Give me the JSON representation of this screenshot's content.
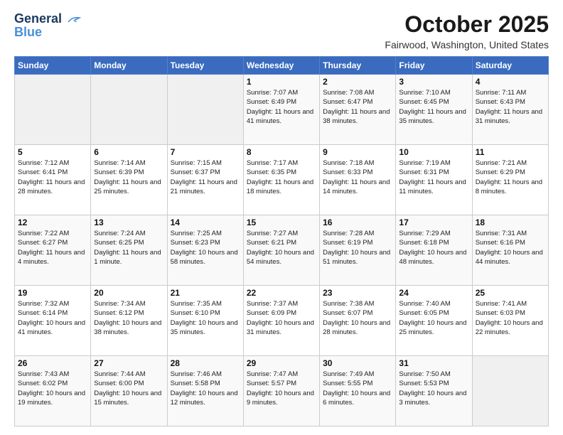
{
  "header": {
    "logo_line1": "General",
    "logo_line2": "Blue",
    "month": "October 2025",
    "location": "Fairwood, Washington, United States"
  },
  "weekdays": [
    "Sunday",
    "Monday",
    "Tuesday",
    "Wednesday",
    "Thursday",
    "Friday",
    "Saturday"
  ],
  "weeks": [
    [
      {
        "day": "",
        "empty": true
      },
      {
        "day": "",
        "empty": true
      },
      {
        "day": "",
        "empty": true
      },
      {
        "day": "1",
        "sunrise": "7:07 AM",
        "sunset": "6:49 PM",
        "daylight": "11 hours and 41 minutes."
      },
      {
        "day": "2",
        "sunrise": "7:08 AM",
        "sunset": "6:47 PM",
        "daylight": "11 hours and 38 minutes."
      },
      {
        "day": "3",
        "sunrise": "7:10 AM",
        "sunset": "6:45 PM",
        "daylight": "11 hours and 35 minutes."
      },
      {
        "day": "4",
        "sunrise": "7:11 AM",
        "sunset": "6:43 PM",
        "daylight": "11 hours and 31 minutes."
      }
    ],
    [
      {
        "day": "5",
        "sunrise": "7:12 AM",
        "sunset": "6:41 PM",
        "daylight": "11 hours and 28 minutes."
      },
      {
        "day": "6",
        "sunrise": "7:14 AM",
        "sunset": "6:39 PM",
        "daylight": "11 hours and 25 minutes."
      },
      {
        "day": "7",
        "sunrise": "7:15 AM",
        "sunset": "6:37 PM",
        "daylight": "11 hours and 21 minutes."
      },
      {
        "day": "8",
        "sunrise": "7:17 AM",
        "sunset": "6:35 PM",
        "daylight": "11 hours and 18 minutes."
      },
      {
        "day": "9",
        "sunrise": "7:18 AM",
        "sunset": "6:33 PM",
        "daylight": "11 hours and 14 minutes."
      },
      {
        "day": "10",
        "sunrise": "7:19 AM",
        "sunset": "6:31 PM",
        "daylight": "11 hours and 11 minutes."
      },
      {
        "day": "11",
        "sunrise": "7:21 AM",
        "sunset": "6:29 PM",
        "daylight": "11 hours and 8 minutes."
      }
    ],
    [
      {
        "day": "12",
        "sunrise": "7:22 AM",
        "sunset": "6:27 PM",
        "daylight": "11 hours and 4 minutes."
      },
      {
        "day": "13",
        "sunrise": "7:24 AM",
        "sunset": "6:25 PM",
        "daylight": "11 hours and 1 minute."
      },
      {
        "day": "14",
        "sunrise": "7:25 AM",
        "sunset": "6:23 PM",
        "daylight": "10 hours and 58 minutes."
      },
      {
        "day": "15",
        "sunrise": "7:27 AM",
        "sunset": "6:21 PM",
        "daylight": "10 hours and 54 minutes."
      },
      {
        "day": "16",
        "sunrise": "7:28 AM",
        "sunset": "6:19 PM",
        "daylight": "10 hours and 51 minutes."
      },
      {
        "day": "17",
        "sunrise": "7:29 AM",
        "sunset": "6:18 PM",
        "daylight": "10 hours and 48 minutes."
      },
      {
        "day": "18",
        "sunrise": "7:31 AM",
        "sunset": "6:16 PM",
        "daylight": "10 hours and 44 minutes."
      }
    ],
    [
      {
        "day": "19",
        "sunrise": "7:32 AM",
        "sunset": "6:14 PM",
        "daylight": "10 hours and 41 minutes."
      },
      {
        "day": "20",
        "sunrise": "7:34 AM",
        "sunset": "6:12 PM",
        "daylight": "10 hours and 38 minutes."
      },
      {
        "day": "21",
        "sunrise": "7:35 AM",
        "sunset": "6:10 PM",
        "daylight": "10 hours and 35 minutes."
      },
      {
        "day": "22",
        "sunrise": "7:37 AM",
        "sunset": "6:09 PM",
        "daylight": "10 hours and 31 minutes."
      },
      {
        "day": "23",
        "sunrise": "7:38 AM",
        "sunset": "6:07 PM",
        "daylight": "10 hours and 28 minutes."
      },
      {
        "day": "24",
        "sunrise": "7:40 AM",
        "sunset": "6:05 PM",
        "daylight": "10 hours and 25 minutes."
      },
      {
        "day": "25",
        "sunrise": "7:41 AM",
        "sunset": "6:03 PM",
        "daylight": "10 hours and 22 minutes."
      }
    ],
    [
      {
        "day": "26",
        "sunrise": "7:43 AM",
        "sunset": "6:02 PM",
        "daylight": "10 hours and 19 minutes."
      },
      {
        "day": "27",
        "sunrise": "7:44 AM",
        "sunset": "6:00 PM",
        "daylight": "10 hours and 15 minutes."
      },
      {
        "day": "28",
        "sunrise": "7:46 AM",
        "sunset": "5:58 PM",
        "daylight": "10 hours and 12 minutes."
      },
      {
        "day": "29",
        "sunrise": "7:47 AM",
        "sunset": "5:57 PM",
        "daylight": "10 hours and 9 minutes."
      },
      {
        "day": "30",
        "sunrise": "7:49 AM",
        "sunset": "5:55 PM",
        "daylight": "10 hours and 6 minutes."
      },
      {
        "day": "31",
        "sunrise": "7:50 AM",
        "sunset": "5:53 PM",
        "daylight": "10 hours and 3 minutes."
      },
      {
        "day": "",
        "empty": true
      }
    ]
  ]
}
